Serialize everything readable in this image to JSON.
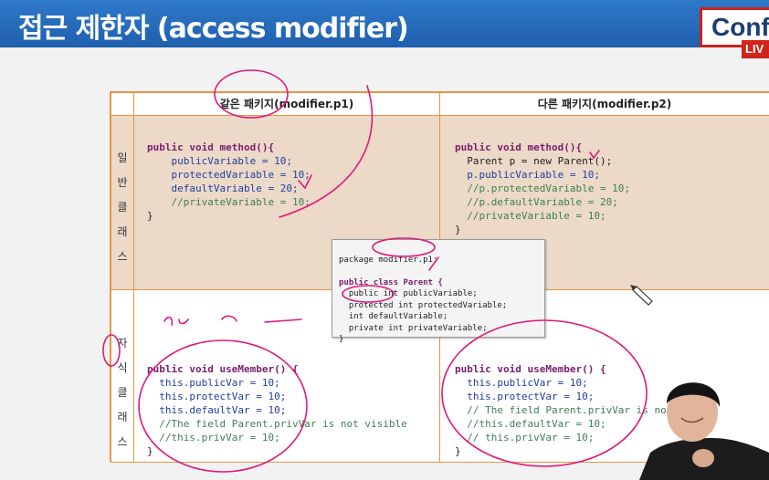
{
  "header": {
    "title": "접근 제한자 (access modifier)",
    "brand": "Conf",
    "live_badge": "LIV"
  },
  "table": {
    "col_same_package": "같은 패키지(modifier.p1)",
    "col_other_package": "다른 패키지(modifier.p2)",
    "row_general": [
      "일",
      "반",
      "클",
      "래",
      "스"
    ],
    "row_child": [
      "자",
      "식",
      "클",
      "래",
      "스"
    ]
  },
  "code": {
    "general_same": [
      "public void method(){",
      "    publicVariable = 10;",
      "    protectedVariable = 10;",
      "    defaultVariable = 20;",
      "    //privateVariable = 10;",
      "}"
    ],
    "general_other": [
      "public void method(){",
      "  Parent p = new Parent();",
      "  p.publicVariable = 10;",
      "  //p.protectedVariable = 10;",
      "  //p.defaultVariable = 20;",
      "  //privateVariable = 10;",
      "}"
    ],
    "child_same": [
      "public void useMember() {",
      "  this.publicVar = 10;",
      "  this.protectVar = 10;",
      "  this.defaultVar = 10;",
      "  //The field Parent.privVar is not visible",
      "  //this.privVar = 10;",
      "}"
    ],
    "child_other": [
      "public void useMember() {",
      "  this.publicVar = 10;",
      "  this.protectVar = 10;",
      "  // The field Parent.privVar is not",
      "  //this.defaultVar = 10;",
      "  // this.privVar = 10;",
      "}"
    ],
    "parent_popup": [
      "package modifier.p1;",
      "",
      "public class Parent {",
      "  public int publicVariable;",
      "  protected int protectedVariable;",
      "  int defaultVariable;",
      "  private int privateVariable;",
      "}"
    ]
  },
  "colors": {
    "title_bar": "#2f79c8",
    "grid_border": "#e8943f",
    "row_general_bg": "#ecd9c8",
    "annotation_pen": "#e0197a"
  },
  "icons": [
    "pencil-icon"
  ]
}
